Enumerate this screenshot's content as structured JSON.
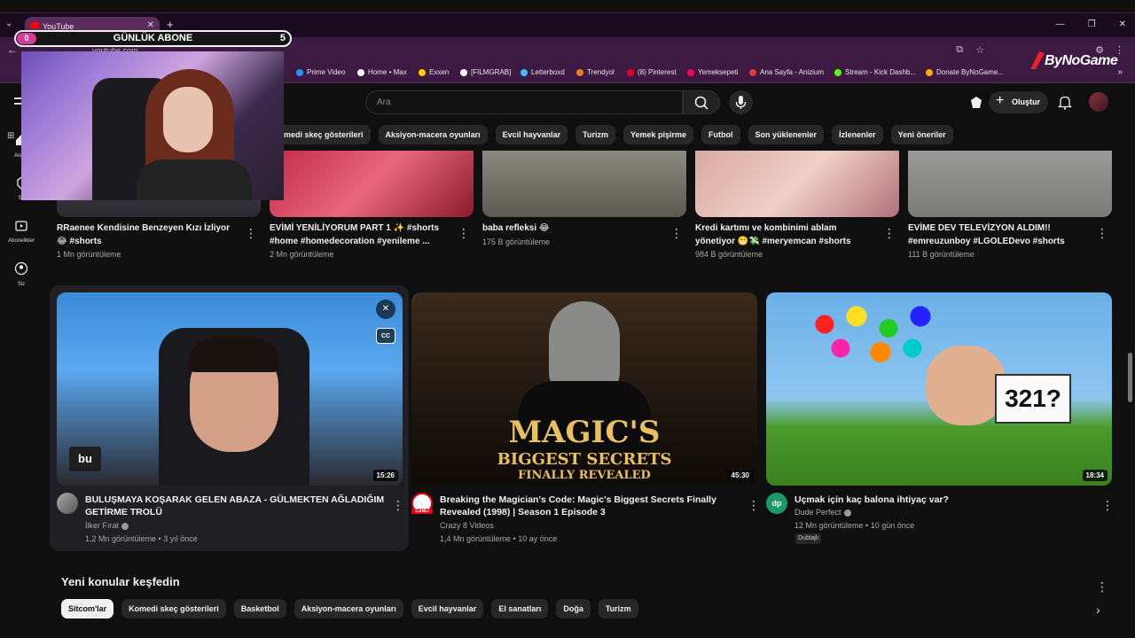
{
  "browser": {
    "tab_title": "YouTube",
    "url": "youtube.com",
    "bookmarks": [
      {
        "label": "Prime Video",
        "color": "#1a98ff"
      },
      {
        "label": "Home • Max",
        "color": "#ffffff"
      },
      {
        "label": "Exxen",
        "color": "#ffcc00"
      },
      {
        "label": "[FILMGRAB]",
        "color": "#ffffff"
      },
      {
        "label": "Letterboxd",
        "color": "#40bcf4"
      },
      {
        "label": "Trendyol",
        "color": "#f27a1a"
      },
      {
        "label": "(8) Pinterest",
        "color": "#e60023"
      },
      {
        "label": "Yemeksepeti",
        "color": "#fa0050"
      },
      {
        "label": "Ana Sayfa - Anizium",
        "color": "#e53935"
      },
      {
        "label": "Stream - Kick Dashb...",
        "color": "#53fc18"
      },
      {
        "label": "Donate ByNoGame...",
        "color": "#ffaa00"
      }
    ]
  },
  "overlay": {
    "counter_left": "0",
    "counter_label": "GÜNLÜK ABONE",
    "counter_right": "5",
    "logo_text": "ByNoGame"
  },
  "youtube": {
    "search_placeholder": "Ara",
    "create_label": "Oluştur",
    "nav": {
      "home": "Ana S",
      "shorts": "Sh",
      "subscriptions": "Abonelikler",
      "you": "Siz"
    },
    "chips_top": [
      "Komedi skeç gösterileri",
      "Aksiyon-macera oyunları",
      "Evcil hayvanlar",
      "Turizm",
      "Yemek pişirme",
      "Futbol",
      "Son yüklenenler",
      "İzlenenler",
      "Yeni öneriler"
    ],
    "shorts": [
      {
        "title": "RRaenee Kendisine Benzeyen Kızı İzliyor 😂 #shorts",
        "views": "1 Mn görüntüleme"
      },
      {
        "title": "EVİMİ YENİLİYORUM PART 1 ✨ #shorts #home #homedecoration #yenileme ...",
        "views": "2 Mn görüntüleme"
      },
      {
        "title": "baba refleksi 😂",
        "views": "175 B görüntüleme"
      },
      {
        "title": "Kredi kartımı ve kombinimi ablam yönetiyor 😬💸 #meryemcan #shorts",
        "views": "984 B görüntüleme"
      },
      {
        "title": "EVİME DEV TELEVİZYON ALDIM!! #emreuzunboy #LGOLEDevo #shorts",
        "views": "111 B görüntüleme"
      }
    ],
    "videos": [
      {
        "title": "BULUŞMAYA KOŞARAK GELEN ABAZA - GÜLMEKTEN AĞLADIĞIM GETİRME TROLÜ",
        "channel": "İlker Fırat",
        "meta": "1,2 Mn görüntüleme • 3 yıl önce",
        "duration": "15:26",
        "caption": "bu"
      },
      {
        "title": "Breaking the Magician's Code: Magic's Biggest Secrets Finally Revealed (1998) | Season 1 Episode 3",
        "channel": "Crazy 8 Videos",
        "meta": "1,4 Mn görüntüleme • 10 ay önce",
        "duration": "45:30",
        "thumb_line1": "MAGIC'S",
        "thumb_line2": "BIGGEST SECRETS",
        "thumb_line3": "FINALLY REVEALED",
        "live_badge": "CANLI"
      },
      {
        "title": "Uçmak için kaç balona ihtiyaç var?",
        "channel": "Dude Perfect",
        "meta": "12 Mn görüntüleme • 10 gün önce",
        "duration": "18:34",
        "sign": "321?",
        "badge": "Dublajlı"
      }
    ],
    "explore_title": "Yeni konular keşfedin",
    "chips_bottom": [
      "Sitcom'lar",
      "Komedi skeç gösterileri",
      "Basketbol",
      "Aksiyon-macera oyunları",
      "Evcil hayvanlar",
      "El sanatları",
      "Doğa",
      "Turizm"
    ]
  },
  "colors": {
    "bg": "#0f0f0f",
    "chrome": "#3d1a42",
    "accent_pink": "#d83b96",
    "youtube_red": "#ff0000"
  }
}
